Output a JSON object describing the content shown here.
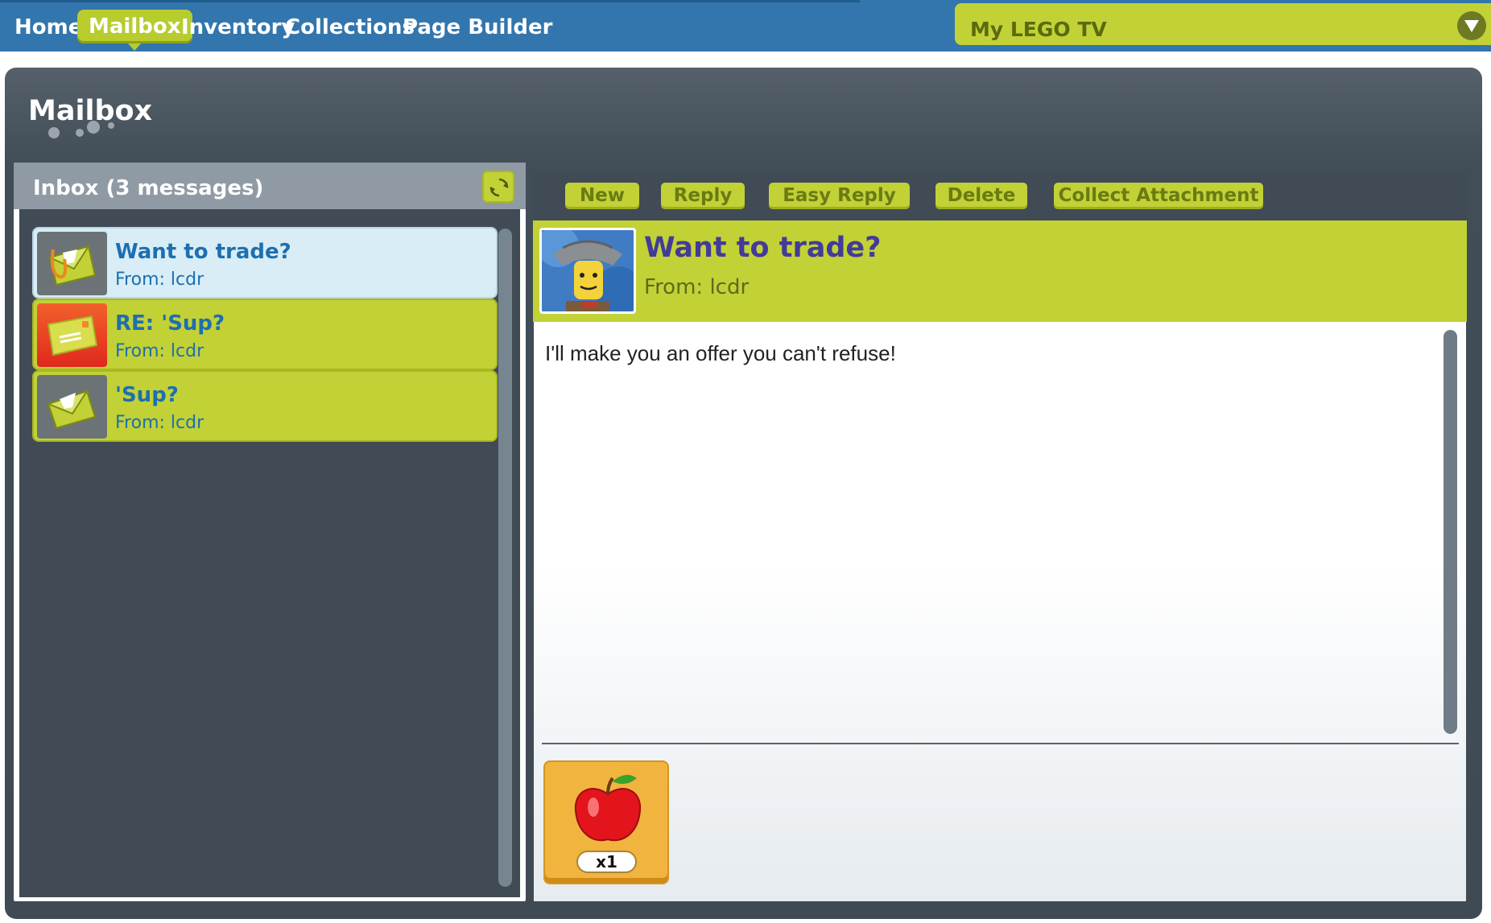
{
  "nav": {
    "items": [
      {
        "label": "Home"
      },
      {
        "label": "Mailbox",
        "active": true
      },
      {
        "label": "Inventory"
      },
      {
        "label": "Collections"
      },
      {
        "label": "Page Builder"
      }
    ],
    "tv_label": "My LEGO TV"
  },
  "panel": {
    "title": "Mailbox"
  },
  "inbox": {
    "title": "Inbox (3 messages)",
    "messages": [
      {
        "subject": "Want to trade?",
        "from": "From: lcdr",
        "selected": true,
        "icon": "envelope-attachment-icon"
      },
      {
        "subject": "RE: 'Sup?",
        "from": "From: lcdr",
        "selected": false,
        "icon": "unread-envelope-icon"
      },
      {
        "subject": "'Sup?",
        "from": "From: lcdr",
        "selected": false,
        "icon": "envelope-open-icon"
      }
    ]
  },
  "toolbar": {
    "new_label": "New",
    "reply_label": "Reply",
    "easy_reply_label": "Easy Reply",
    "delete_label": "Delete",
    "collect_label": "Collect Attachment"
  },
  "message": {
    "subject": "Want to trade?",
    "from": "From: lcdr",
    "body": "I'll make you an offer you can't refuse!",
    "attachment": {
      "icon": "apple-icon",
      "count": "x1"
    }
  },
  "colors": {
    "nav_blue": "#3276ad",
    "lime": "#c2d136",
    "panel_dark": "#404b55",
    "subject_purple": "#433b99",
    "link_blue": "#1d6fb0"
  }
}
